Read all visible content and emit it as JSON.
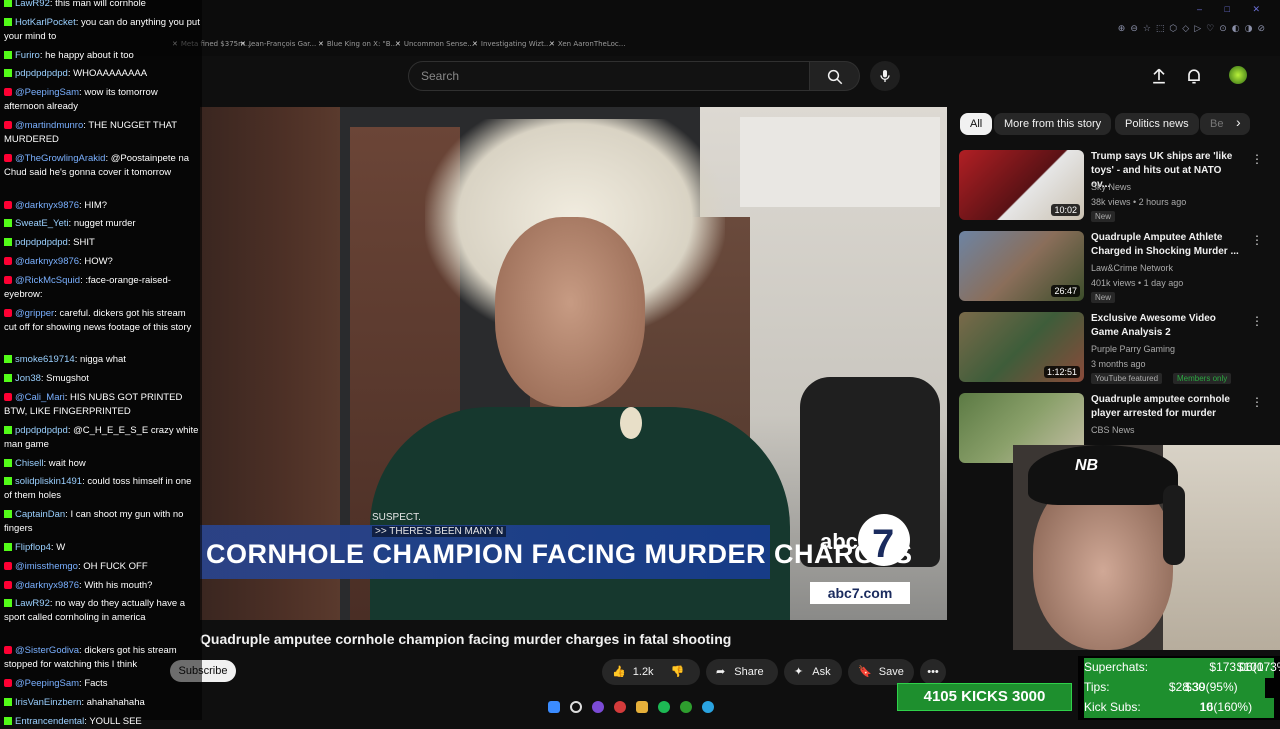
{
  "browser": {
    "tabs": [
      "Meta fined $375m...",
      "Jean-François Gar...",
      "Blue King on X: \"B...",
      "Uncommon Sense...",
      "Investigating Wizt...",
      "Xen AaronTheLoc..."
    ]
  },
  "header": {
    "search_placeholder": "Search",
    "icons": [
      "upload-icon",
      "bell-icon",
      "avatar"
    ]
  },
  "chips": [
    "All",
    "More from this story",
    "Politics news",
    "Be"
  ],
  "video": {
    "caption_line1": "SUSPECT.",
    "caption_line2": ">> THERE'S BEEN MANY N",
    "headline": "CORNHOLE CHAMPION FACING MURDER CHARGES",
    "channel_url": "abc7.com",
    "title": "Quadruple amputee cornhole champion facing murder charges in fatal shooting",
    "likes": "1.2k",
    "share_label": "Share",
    "ask_label": "Ask",
    "save_label": "Save",
    "subscribe_label": "Subscribe"
  },
  "recommendations": [
    {
      "title": "Trump says UK ships are 'like toys' - and hits out at NATO ov...",
      "channel": "Sky News",
      "meta": "38k views • 2 hours ago",
      "badge": "New",
      "duration": "10:02",
      "thumb_color": "#b11f24"
    },
    {
      "title": "Quadruple Amputee Athlete Charged in Shocking Murder ...",
      "channel": "Law&Crime Network",
      "meta": "401k views • 1 day ago",
      "badge": "New",
      "duration": "26:47",
      "thumb_color": "#5a6e8a"
    },
    {
      "title": "Exclusive Awesome Video Game Analysis 2",
      "channel": "Purple Parry Gaming",
      "meta": "3 months ago",
      "badge": "YouTube featured",
      "extra": "Members only",
      "duration": "1:12:51",
      "thumb_color": "#6b5a3a"
    },
    {
      "title": "Quadruple amputee cornhole player arrested for murder",
      "channel": "CBS News",
      "meta": "",
      "badge": "",
      "duration": "",
      "thumb_color": "#4f6a3c"
    }
  ],
  "chat": [
    {
      "platform": "kick",
      "user": "LawR92",
      "user_color": "#9ad0ff",
      "text": "this man will cornhole"
    },
    {
      "platform": "kick",
      "user": "HotKarlPocket",
      "user_color": "#9ad0ff",
      "text": "you can do anything you put your mind to"
    },
    {
      "platform": "kick",
      "user": "Furiro",
      "user_color": "#9ad0ff",
      "text": "he happy about it too"
    },
    {
      "platform": "kick",
      "user": "pdpdpdpdpd",
      "user_color": "#9ad0ff",
      "text": "WHOAAAAAAAA"
    },
    {
      "platform": "yt",
      "user": "@PeepingSam",
      "user_color": "#7ab0ff",
      "text": "wow its tomorrow afternoon already"
    },
    {
      "platform": "yt",
      "user": "@martindmunro",
      "user_color": "#7ab0ff",
      "text": "THE NUGGET THAT MURDERED"
    },
    {
      "platform": "yt",
      "user": "@TheGrowlingArakid",
      "user_color": "#7ab0ff",
      "text": "@Poostainpete na Chud said he's gonna cover it tomorrow"
    },
    {
      "platform": "yt",
      "user": "@darknyx9876",
      "user_color": "#7ab0ff",
      "text": "HIM?"
    },
    {
      "platform": "kick",
      "user": "SweatE_Yeti",
      "user_color": "#9ad0ff",
      "text": "nugget murder"
    },
    {
      "platform": "kick",
      "user": "pdpdpdpdpd",
      "user_color": "#9ad0ff",
      "text": "SHIT"
    },
    {
      "platform": "yt",
      "user": "@darknyx9876",
      "user_color": "#7ab0ff",
      "text": "HOW?"
    },
    {
      "platform": "yt",
      "user": "@RickMcSquid",
      "user_color": "#7ab0ff",
      "text": ":face-orange-raised-eyebrow:"
    },
    {
      "platform": "yt",
      "user": "@gripper",
      "user_color": "#7ab0ff",
      "text": "careful. dickers got his stream cut off for showing news footage of this story"
    },
    {
      "platform": "kick",
      "user": "smoke619714",
      "user_color": "#9ad0ff",
      "text": "nigga what"
    },
    {
      "platform": "kick",
      "user": "Jon38",
      "user_color": "#9ad0ff",
      "text": "Smugshot"
    },
    {
      "platform": "yt",
      "user": "@Cali_Mari",
      "user_color": "#7ab0ff",
      "text": "HIS NUBS GOT PRINTED BTW, LIKE FINGERPRINTED"
    },
    {
      "platform": "kick",
      "user": "pdpdpdpdpd",
      "user_color": "#9ad0ff",
      "text": "@C_H_E_E_S_E crazy white man game"
    },
    {
      "platform": "kick",
      "user": "Chisell",
      "user_color": "#9ad0ff",
      "text": "wait how"
    },
    {
      "platform": "kick",
      "user": "solidpliskin1491",
      "user_color": "#9ad0ff",
      "text": "could toss himself in one of them holes"
    },
    {
      "platform": "kick",
      "user": "CaptainDan",
      "user_color": "#9ad0ff",
      "text": "I can shoot my gun with no fingers"
    },
    {
      "platform": "kick",
      "user": "Flipflop4",
      "user_color": "#9ad0ff",
      "text": "W"
    },
    {
      "platform": "yt",
      "user": "@imissthemgo",
      "user_color": "#7ab0ff",
      "text": "OH FUCK OFF"
    },
    {
      "platform": "yt",
      "user": "@darknyx9876",
      "user_color": "#7ab0ff",
      "text": "With his mouth?"
    },
    {
      "platform": "kick",
      "user": "LawR92",
      "user_color": "#9ad0ff",
      "text": "no way do they actually have a sport called cornholing in america"
    },
    {
      "platform": "yt",
      "user": "@SisterGodiva",
      "user_color": "#7ab0ff",
      "text": "dickers got his stream stopped for watching this I think"
    },
    {
      "platform": "yt",
      "user": "@PeepingSam",
      "user_color": "#7ab0ff",
      "text": "Facts"
    },
    {
      "platform": "kick",
      "user": "IrisVanEinzbern",
      "user_color": "#9ad0ff",
      "text": "ahahahahaha"
    },
    {
      "platform": "kick",
      "user": "Entrancendental",
      "user_color": "#9ad0ff",
      "text": "YOULL SEE"
    }
  ],
  "webcam": {
    "cap_logo": "NB"
  },
  "stream_stats": {
    "kicks_text": "4105  KICKS  3000",
    "kicks_progress": 1.0,
    "rows": [
      {
        "label": "Superchats:",
        "value": "$173.06(173%)",
        "goal": "$100",
        "progress": 1.0
      },
      {
        "label": "Tips:",
        "value": "$28.39(95%)",
        "goal": "$30",
        "progress": 0.95
      },
      {
        "label": "Kick Subs:",
        "value": "16(160%)",
        "goal": "10",
        "progress": 1.0
      }
    ]
  },
  "taskbar": {
    "icons": [
      "windows-icon",
      "search-icon",
      "browser-icon",
      "chrome-icon",
      "files-icon",
      "spotify-icon",
      "xbox-icon",
      "telegram-icon"
    ]
  }
}
